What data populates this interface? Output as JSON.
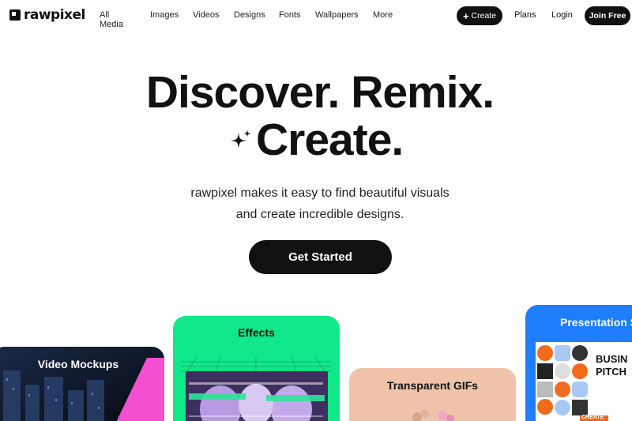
{
  "brand": {
    "name": "rawpixel"
  },
  "nav": {
    "links": [
      "All Media",
      "Images",
      "Videos",
      "Designs",
      "Fonts",
      "Wallpapers",
      "More"
    ],
    "create_label": "Create",
    "plans_label": "Plans",
    "login_label": "Login",
    "join_label": "Join Free"
  },
  "hero": {
    "line1": "Discover. Remix.",
    "line2": "Create.",
    "sub1": "rawpixel makes it easy to find beautiful visuals",
    "sub2": "and create incredible designs.",
    "cta_label": "Get Started"
  },
  "cards": {
    "video": {
      "title": "Video Mockups"
    },
    "effects": {
      "title": "Effects"
    },
    "gifs": {
      "title": "Transparent GIFs"
    },
    "presentation": {
      "title": "Presentation Slides",
      "slide_heading": "BUSIN PITCH",
      "slide_footer": "CREATE"
    }
  },
  "colors": {
    "effects_bg": "#10e88a",
    "gifs_bg": "#eec3a9",
    "presentation_bg": "#1d7dfa",
    "accent_orange": "#f26b1d"
  }
}
